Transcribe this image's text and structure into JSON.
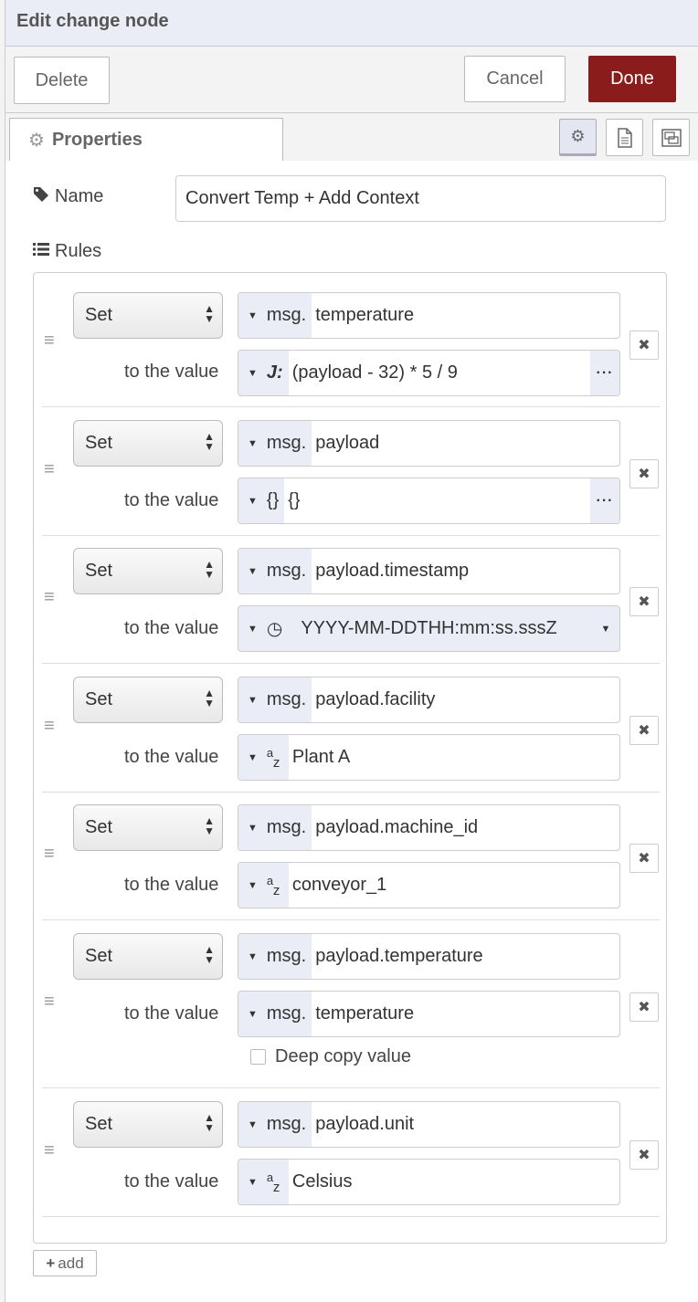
{
  "header": {
    "title": "Edit change node"
  },
  "toolbar": {
    "delete_label": "Delete",
    "cancel_label": "Cancel",
    "done_label": "Done",
    "done_color": "#8b1c1c"
  },
  "tabs": {
    "properties_label": "Properties"
  },
  "form": {
    "name_label": "Name",
    "name_value": "Convert Temp + Add Context",
    "rules_label": "Rules",
    "add_label": "add"
  },
  "rules": [
    {
      "action": "Set",
      "target_type": "msg.",
      "target": "temperature",
      "to_label": "to the value",
      "value_type": "J:",
      "value_type_icon": "jsonata-icon",
      "value": "(payload - 32) * 5 / 9",
      "has_expand": true
    },
    {
      "action": "Set",
      "target_type": "msg.",
      "target": "payload",
      "to_label": "to the value",
      "value_type": "{}",
      "value_type_icon": "json-icon",
      "value": "{}",
      "has_expand": true
    },
    {
      "action": "Set",
      "target_type": "msg.",
      "target": "payload.timestamp",
      "to_label": "to the value",
      "value_type": "◷",
      "value_type_icon": "clock-icon",
      "value": "YYYY-MM-DDTHH:mm:ss.sssZ",
      "has_dropdown": true
    },
    {
      "action": "Set",
      "target_type": "msg.",
      "target": "payload.facility",
      "to_label": "to the value",
      "value_type_icon": "string-icon",
      "value": "Plant A"
    },
    {
      "action": "Set",
      "target_type": "msg.",
      "target": "payload.machine_id",
      "to_label": "to the value",
      "value_type_icon": "string-icon",
      "value": "conveyor_1"
    },
    {
      "action": "Set",
      "target_type": "msg.",
      "target": "payload.temperature",
      "to_label": "to the value",
      "value_type": "msg.",
      "value": "temperature",
      "deep_copy_label": "Deep copy value"
    },
    {
      "action": "Set",
      "target_type": "msg.",
      "target": "payload.unit",
      "to_label": "to the value",
      "value_type_icon": "string-icon",
      "value": "Celsius"
    }
  ]
}
